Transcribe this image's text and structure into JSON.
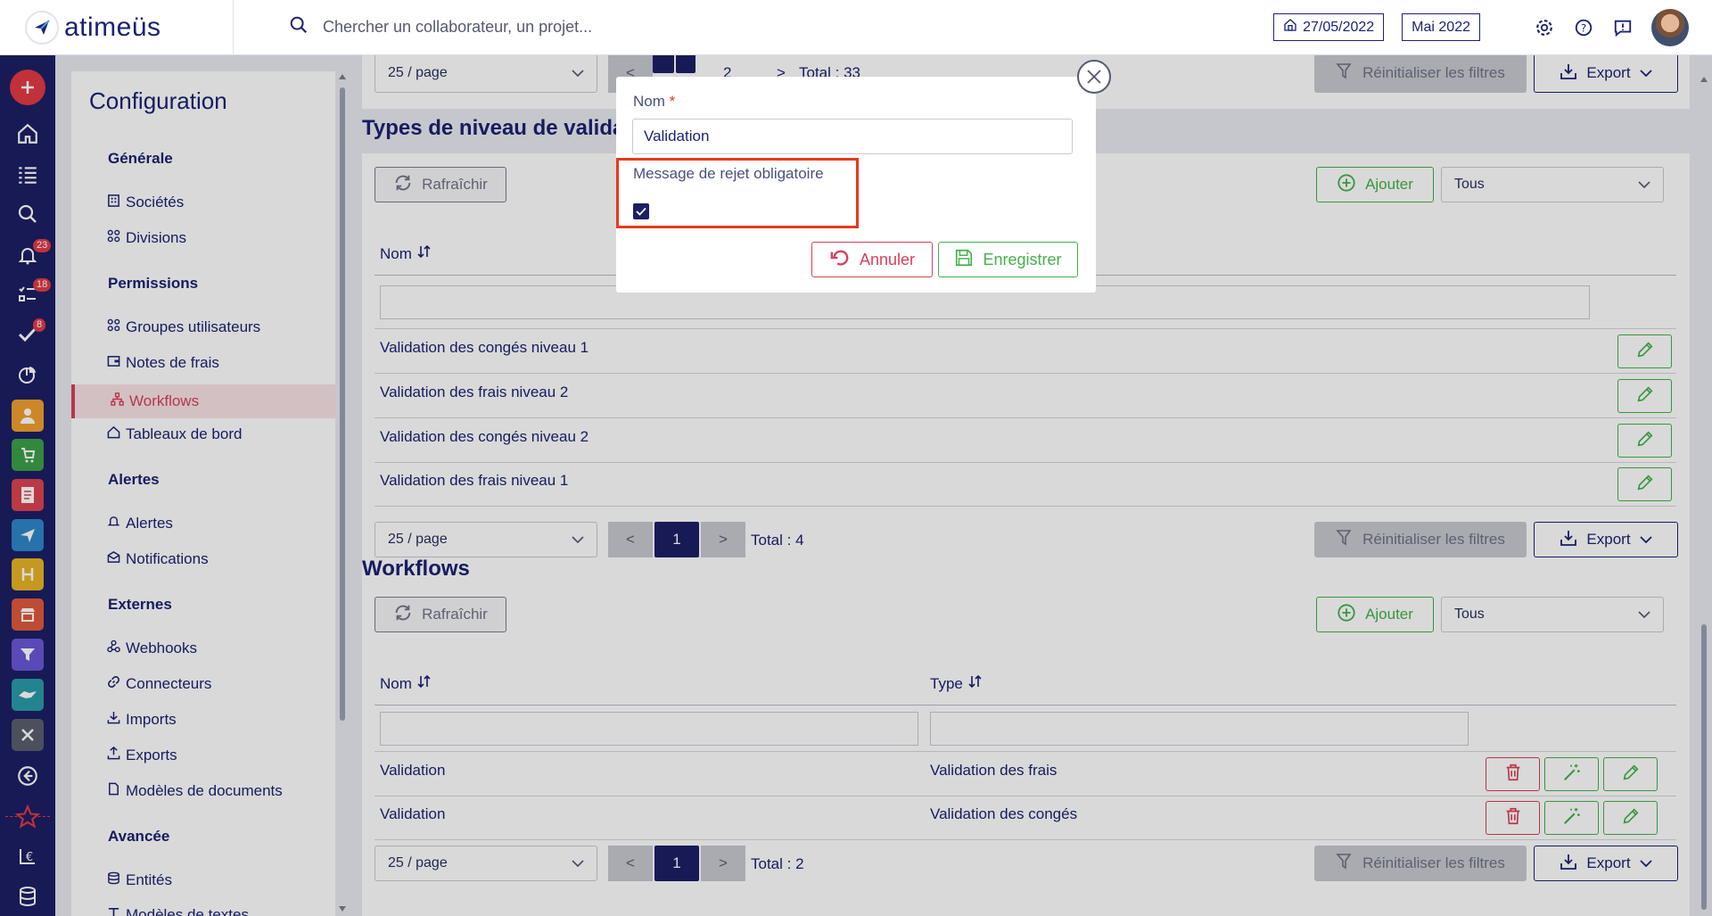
{
  "brand": {
    "name": "atimeüs"
  },
  "search": {
    "placeholder": "Chercher un collaborateur, un projet..."
  },
  "header": {
    "date": "27/05/2022",
    "period": "Mai 2022"
  },
  "iconbar": {
    "badges": {
      "notifications": "23",
      "tasks": "18",
      "validations": "8"
    }
  },
  "config": {
    "title": "Configuration",
    "sections": {
      "generale": "Générale",
      "permissions": "Permissions",
      "alertes": "Alertes",
      "externes": "Externes",
      "avancee": "Avancée"
    },
    "items": {
      "societes": "Sociétés",
      "divisions": "Divisions",
      "groupes": "Groupes utilisateurs",
      "notes": "Notes de frais",
      "workflows": "Workflows",
      "tableaux": "Tableaux de bord",
      "alertes": "Alertes",
      "notifications": "Notifications",
      "webhooks": "Webhooks",
      "connecteurs": "Connecteurs",
      "imports": "Imports",
      "exports": "Exports",
      "modeles_docs": "Modèles de documents",
      "entites": "Entités",
      "modeles_textes": "Modèles de textes"
    }
  },
  "common": {
    "refresh": "Rafraîchir",
    "add": "Ajouter",
    "filter_all": "Tous",
    "page_size": "25 / page",
    "prev": "<",
    "next": ">",
    "reset_filters": "Réinitialiser les filtres",
    "export": "Export",
    "col_nom": "Nom",
    "col_type": "Type"
  },
  "top_partial": {
    "page_2": "2",
    "total": "Total : 33"
  },
  "types_section": {
    "title": "Types de niveau de validation",
    "rows": [
      "Validation des congés niveau 1",
      "Validation des frais niveau 2",
      "Validation des congés niveau 2",
      "Validation des frais niveau 1"
    ],
    "page": "1",
    "total": "Total : 4"
  },
  "workflows_section": {
    "title": "Workflows",
    "rows": [
      {
        "nom": "Validation",
        "type": "Validation des frais"
      },
      {
        "nom": "Validation",
        "type": "Validation des congés"
      }
    ],
    "page": "1",
    "total": "Total : 2"
  },
  "modal": {
    "name_label": "Nom",
    "required_mark": "*",
    "name_value": "Validation",
    "checkbox_label": "Message de rejet obligatoire",
    "checkbox_checked": true,
    "cancel": "Annuler",
    "save": "Enregistrer"
  },
  "colors": {
    "navy": "#1c2272",
    "accent_red": "#d8405a",
    "green": "#44b04c",
    "highlight": "#e8391d"
  }
}
